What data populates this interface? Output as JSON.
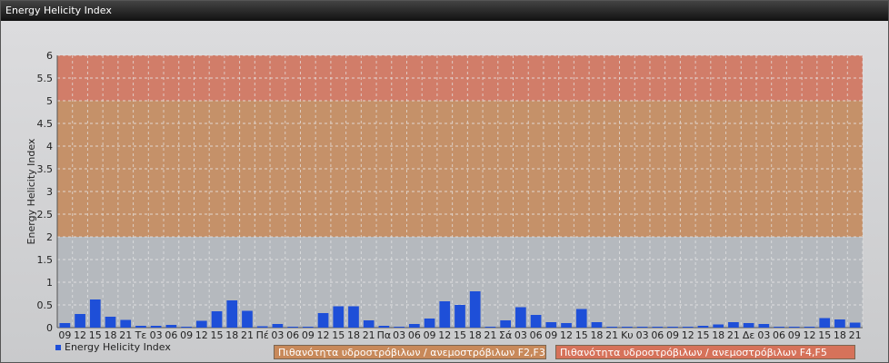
{
  "window": {
    "title": "Energy Helicity Index"
  },
  "legend": {
    "series_label": "Energy Helicity Index"
  },
  "zones": [
    {
      "label": "Πιθανότητα υδροστρόβιλων / ανεμοστρόβιλων F2,F3",
      "from": 2,
      "to": 5,
      "color": "#c8895a"
    },
    {
      "label": "Πιθανότητα υδροστρόβιλων / ανεμοστρόβιλων F4,F5",
      "from": 5,
      "to": 6,
      "color": "#d6725a"
    }
  ],
  "chart_data": {
    "type": "bar",
    "ylabel": "Energy Helicity Index",
    "ylim": [
      0,
      6
    ],
    "yticks": [
      "0",
      "0.5",
      "1",
      "1.5",
      "2",
      "2.5",
      "3",
      "3.5",
      "4",
      "4.5",
      "5",
      "5.5",
      "6"
    ],
    "grid": true,
    "bar_color": "#1e4fd8",
    "categories": [
      "09",
      "12",
      "15",
      "18",
      "21",
      "Τε",
      "03",
      "06",
      "09",
      "12",
      "15",
      "18",
      "21",
      "Πέ",
      "03",
      "06",
      "09",
      "12",
      "15",
      "18",
      "21",
      "Πα",
      "03",
      "06",
      "09",
      "12",
      "15",
      "18",
      "21",
      "Σά",
      "03",
      "06",
      "09",
      "12",
      "15",
      "18",
      "21",
      "Κυ",
      "03",
      "06",
      "09",
      "12",
      "15",
      "18",
      "21",
      "Δε",
      "03",
      "06",
      "09",
      "12",
      "15",
      "18",
      "21"
    ],
    "values": [
      0.1,
      0.3,
      0.62,
      0.24,
      0.17,
      0.04,
      0.04,
      0.06,
      0.02,
      0.15,
      0.36,
      0.6,
      0.37,
      0.03,
      0.08,
      0.02,
      0.02,
      0.32,
      0.47,
      0.47,
      0.16,
      0.04,
      0.02,
      0.08,
      0.2,
      0.58,
      0.5,
      0.8,
      0.02,
      0.16,
      0.45,
      0.28,
      0.12,
      0.1,
      0.41,
      0.12,
      0.02,
      0.02,
      0.02,
      0.02,
      0.02,
      0.02,
      0.04,
      0.07,
      0.12,
      0.1,
      0.08,
      0.02,
      0.02,
      0.02,
      0.21,
      0.18,
      0.11
    ]
  }
}
